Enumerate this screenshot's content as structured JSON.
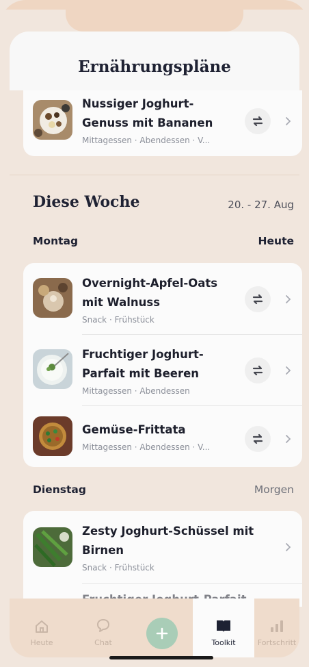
{
  "header": {
    "title": "Ernährungspläne"
  },
  "top_meal": {
    "title": "Nussiger Joghurt-Genuss mit Bananen",
    "title_lines": [
      "Nussiger Joghurt-",
      "Genuss mit Bananen"
    ],
    "tags": "Mittagessen · Abendessen · V..."
  },
  "week": {
    "title": "Diese Woche",
    "range": "20. - 27. Aug"
  },
  "days": [
    {
      "name": "Montag",
      "right_label": "Heute",
      "meals": [
        {
          "title_lines": [
            "Overnight-Apfel-Oats",
            "mit Walnuss"
          ],
          "tags": "Snack · Frühstück"
        },
        {
          "title_lines": [
            "Fruchtiger Joghurt-",
            "Parfait mit Beeren"
          ],
          "tags": "Mittagessen · Abendessen"
        },
        {
          "title_lines": [
            "Gemüse-Frittata"
          ],
          "tags": "Mittagessen · Abendessen · V..."
        }
      ]
    },
    {
      "name": "Dienstag",
      "right_label": "Morgen",
      "meals": [
        {
          "title_lines": [
            "Zesty Joghurt-Schüssel mit",
            "Birnen"
          ],
          "tags": "Snack · Frühstück"
        },
        {
          "title_lines": [
            "Fruchtiger Joghurt-Parfait"
          ],
          "tags": ""
        }
      ]
    }
  ],
  "tabs": [
    {
      "label": "Heute",
      "icon": "home-icon"
    },
    {
      "label": "Chat",
      "icon": "chat-icon"
    },
    {
      "label": "",
      "icon": "plus-icon"
    },
    {
      "label": "Toolkit",
      "icon": "book-icon"
    },
    {
      "label": "Fortschritt",
      "icon": "bar-chart-icon"
    }
  ],
  "colors": {
    "accent": "#a9cdb7",
    "background": "#f1e6dd",
    "card": "#fbfbfb"
  }
}
